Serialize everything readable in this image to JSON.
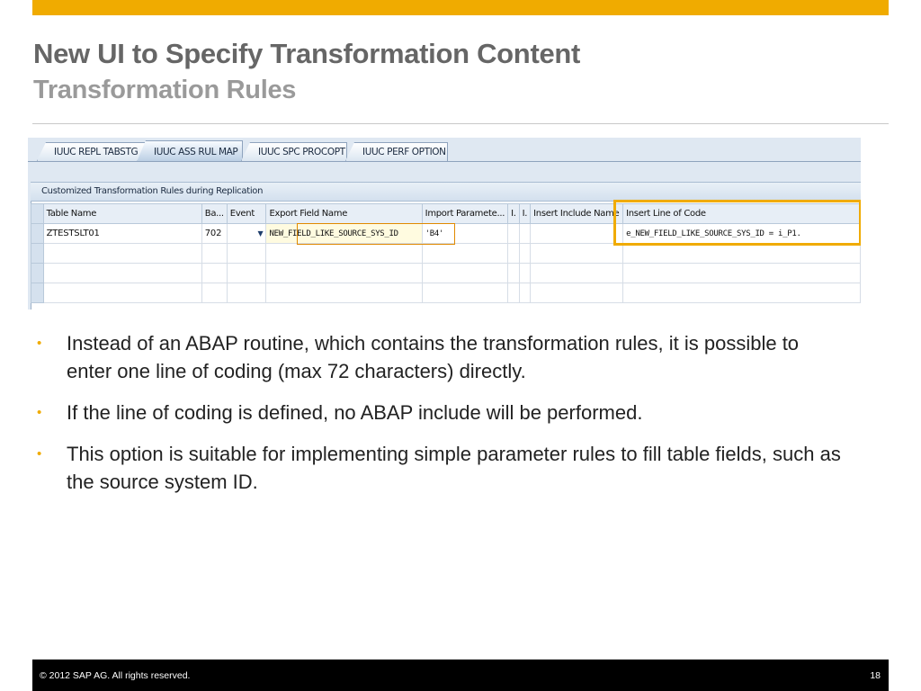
{
  "slide": {
    "title": "New UI to Specify Transformation Content",
    "subtitle": "Transformation Rules",
    "footer_copyright": "©  2012 SAP AG. All rights reserved.",
    "page_number": "18",
    "accent_color": "#f0ab00"
  },
  "sap": {
    "tabs": [
      "IUUC REPL TABSTG",
      "IUUC ASS RUL MAP",
      "IUUC SPC PROCOPT",
      "IUUC PERF OPTION"
    ],
    "active_tab": "IUUC ASS RUL MAP",
    "panel_title": "Customized Transformation Rules during Replication",
    "columns": [
      "Table Name",
      "Ba...",
      "Event",
      "Export Field Name",
      "Import Paramete...",
      "I.",
      "I.",
      "Insert Include Name",
      "Insert Line of Code"
    ],
    "rows": [
      {
        "table_name": "ZTESTSLT01",
        "ba": "702",
        "event": "",
        "export_field": "NEW_FIELD_LIKE_SOURCE_SYS_ID",
        "import_param": "'B4'",
        "i1": "",
        "i2": "",
        "include_name": "",
        "line_of_code": "e_NEW_FIELD_LIKE_SOURCE_SYS_ID = i_P1."
      }
    ],
    "empty_rows": 3
  },
  "bullets": [
    "Instead of an ABAP routine, which contains the transformation rules, it is possible to enter one line of coding (max 72 characters) directly.",
    "If the line of coding is defined, no ABAP include will be performed.",
    "This option is suitable for implementing simple parameter rules to fill table fields, such as the source system ID."
  ]
}
